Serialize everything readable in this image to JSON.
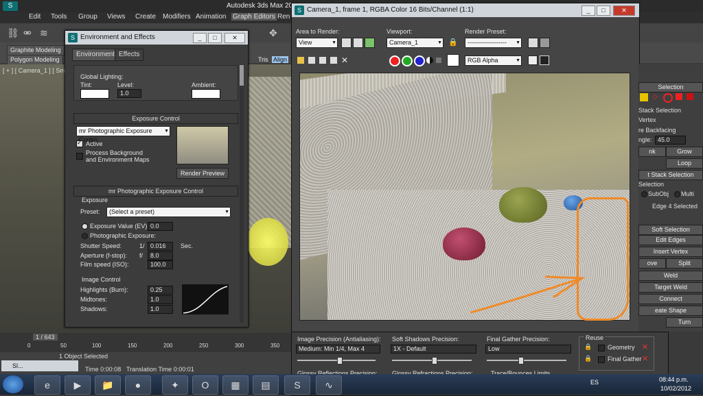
{
  "app": {
    "title": "Autodesk 3ds Max 201",
    "menus": [
      "Edit",
      "Tools",
      "Group",
      "Views",
      "Create",
      "Modifiers",
      "Animation",
      "Graph Editors",
      "Ren"
    ]
  },
  "ribbon": {
    "tab1": "Graphite Modeling",
    "tab2": "Polygon Modeling"
  },
  "viewport": {
    "label": "[ + ] [ Camera_1 ] [ Smoo",
    "toolbar_tris": "Tris",
    "toolbar_align": "Align"
  },
  "env": {
    "title": "Environment and Effects",
    "tabs": [
      "Environment",
      "Effects"
    ],
    "global_lighting": "Global Lighting:",
    "tint": "Tint:",
    "level": "Level:",
    "level_value": "1.0",
    "ambient": "Ambient:",
    "exposure_control": "Exposure Control",
    "exposure_type": "mr Photographic Exposure Contro",
    "active": "Active",
    "process_bg": "Process Background",
    "process_bg2": "and Environment Maps",
    "render_preview": "Render Preview",
    "mr_header": "mr Photographic Exposure Control",
    "exposure_group": "Exposure",
    "preset_label": "Preset:",
    "preset_value": "(Select a preset)",
    "ev_label": "Exposure Value (EV):",
    "ev_value": "0.0",
    "photo_label": "Photographic Exposure:",
    "shutter_label": "Shutter Speed:",
    "shutter_prefix": "1/",
    "shutter_value": "0.016",
    "shutter_unit": "Sec.",
    "aperture_label": "Aperture (f-stop):",
    "aperture_prefix": "f/",
    "aperture_value": "8.0",
    "film_label": "Film speed (ISO):",
    "film_value": "100.0",
    "image_control": "Image Control",
    "highlights_label": "Highlights (Burn):",
    "highlights_value": "0.25",
    "midtones_label": "Midtones:",
    "midtones_value": "1.0",
    "shadows_label": "Shadows:",
    "shadows_value": "1.0"
  },
  "cam": {
    "title": "Camera_1, frame 1, RGBA Color 16 Bits/Channel (1:1)",
    "area_label": "Area to Render:",
    "area_value": "View",
    "viewport_label": "Viewport:",
    "viewport_value": "Camera_1",
    "preset_label": "Render Preset:",
    "preset_value": "-------------------",
    "channel_value": "RGB Alpha"
  },
  "settings": {
    "image_precision_label": "Image Precision (Antialiasing):",
    "image_precision_value": "Medium: Min 1/4, Max 4",
    "soft_shadows_label": "Soft Shadows Precision:",
    "soft_shadows_value": "1X - Default",
    "final_gather_label": "Final Gather Precision:",
    "final_gather_value": "Low",
    "reuse_label": "Reuse",
    "geometry": "Geometry",
    "final_gather_chk": "Final Gather",
    "glossy_refl": "Glossy Reflections Precision:",
    "glossy_refr": "Glossy Refractions Precision:",
    "trace": "Trace/Bounces Limits"
  },
  "cmd": {
    "selection": "Selection",
    "stack_selection": "Stack Selection",
    "vertex": "Vertex",
    "backfacing": "re Backfacing",
    "angle_label": "ngle:",
    "angle_value": "45.0",
    "shrink": "nk",
    "grow": "Grow",
    "loop": "Loop",
    "get_stack": "t Stack Selection",
    "selection2": "Selection",
    "subobj": "SubObj",
    "multi": "Multi",
    "edge_selected": "Edge 4 Selected",
    "soft_selection": "Soft Selection",
    "edit_edges": "Edit Edges",
    "insert_vertex": "Insert Vertex",
    "move": "ove",
    "split": "Split",
    "weld": "Weld",
    "target_weld": "Target Weld",
    "connect": "Connect",
    "create_shape": "eate Shape",
    "turn": "Turn"
  },
  "timeline": {
    "frame": "1 / 643",
    "ticks": [
      "0",
      "50",
      "100",
      "150",
      "200",
      "250",
      "300",
      "350"
    ]
  },
  "status": {
    "selected": "1 Object Selected",
    "render_time": "Time 0:00:08",
    "translation_time": "Translation Time 0:00:01",
    "mini_title": "Sl..."
  },
  "taskbar": {
    "lang": "ES",
    "time": "08:44 p.m.",
    "date": "10/02/2012"
  }
}
